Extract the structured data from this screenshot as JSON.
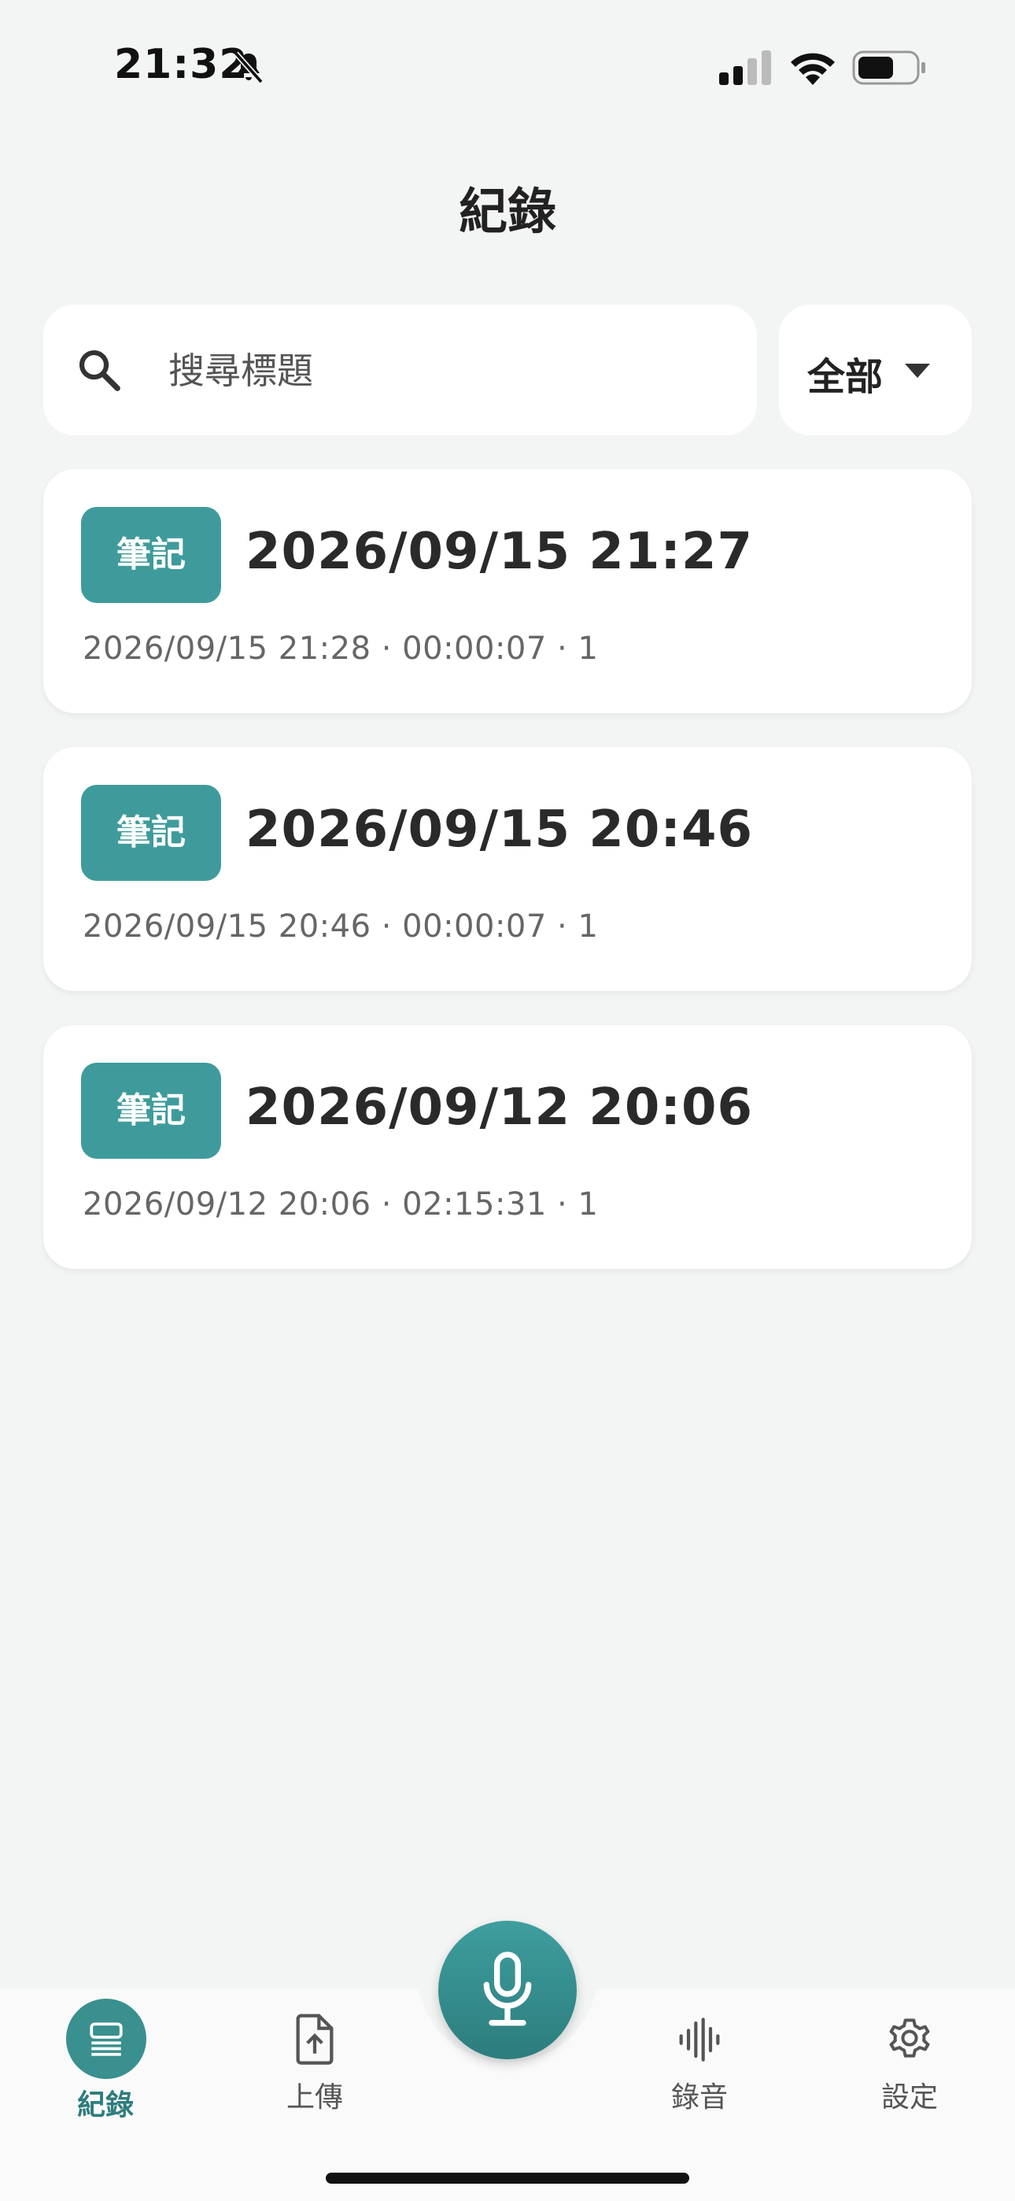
{
  "status_bar": {
    "time": "21:32"
  },
  "header": {
    "title": "紀錄"
  },
  "search": {
    "placeholder": "搜尋標題"
  },
  "filter": {
    "selected": "全部"
  },
  "records": [
    {
      "badge": "筆記",
      "title": "2026/09/15 21:27",
      "meta": "2026/09/15 21:28 · 00:00:07 · 1"
    },
    {
      "badge": "筆記",
      "title": "2026/09/15 20:46",
      "meta": "2026/09/15 20:46 · 00:00:07 · 1"
    },
    {
      "badge": "筆記",
      "title": "2026/09/12 20:06",
      "meta": "2026/09/12 20:06 · 02:15:31 · 1"
    }
  ],
  "tabs": {
    "records": "紀錄",
    "upload": "上傳",
    "recording": "錄音",
    "settings": "設定"
  },
  "colors": {
    "accent": "#3f9b9b",
    "background": "#f3f5f4"
  },
  "icons": [
    "bell-off-icon",
    "signal-icon",
    "wifi-icon",
    "battery-icon",
    "search-icon",
    "caret-down-icon",
    "records-icon",
    "upload-file-icon",
    "microphone-icon",
    "waveform-icon",
    "gear-icon"
  ]
}
